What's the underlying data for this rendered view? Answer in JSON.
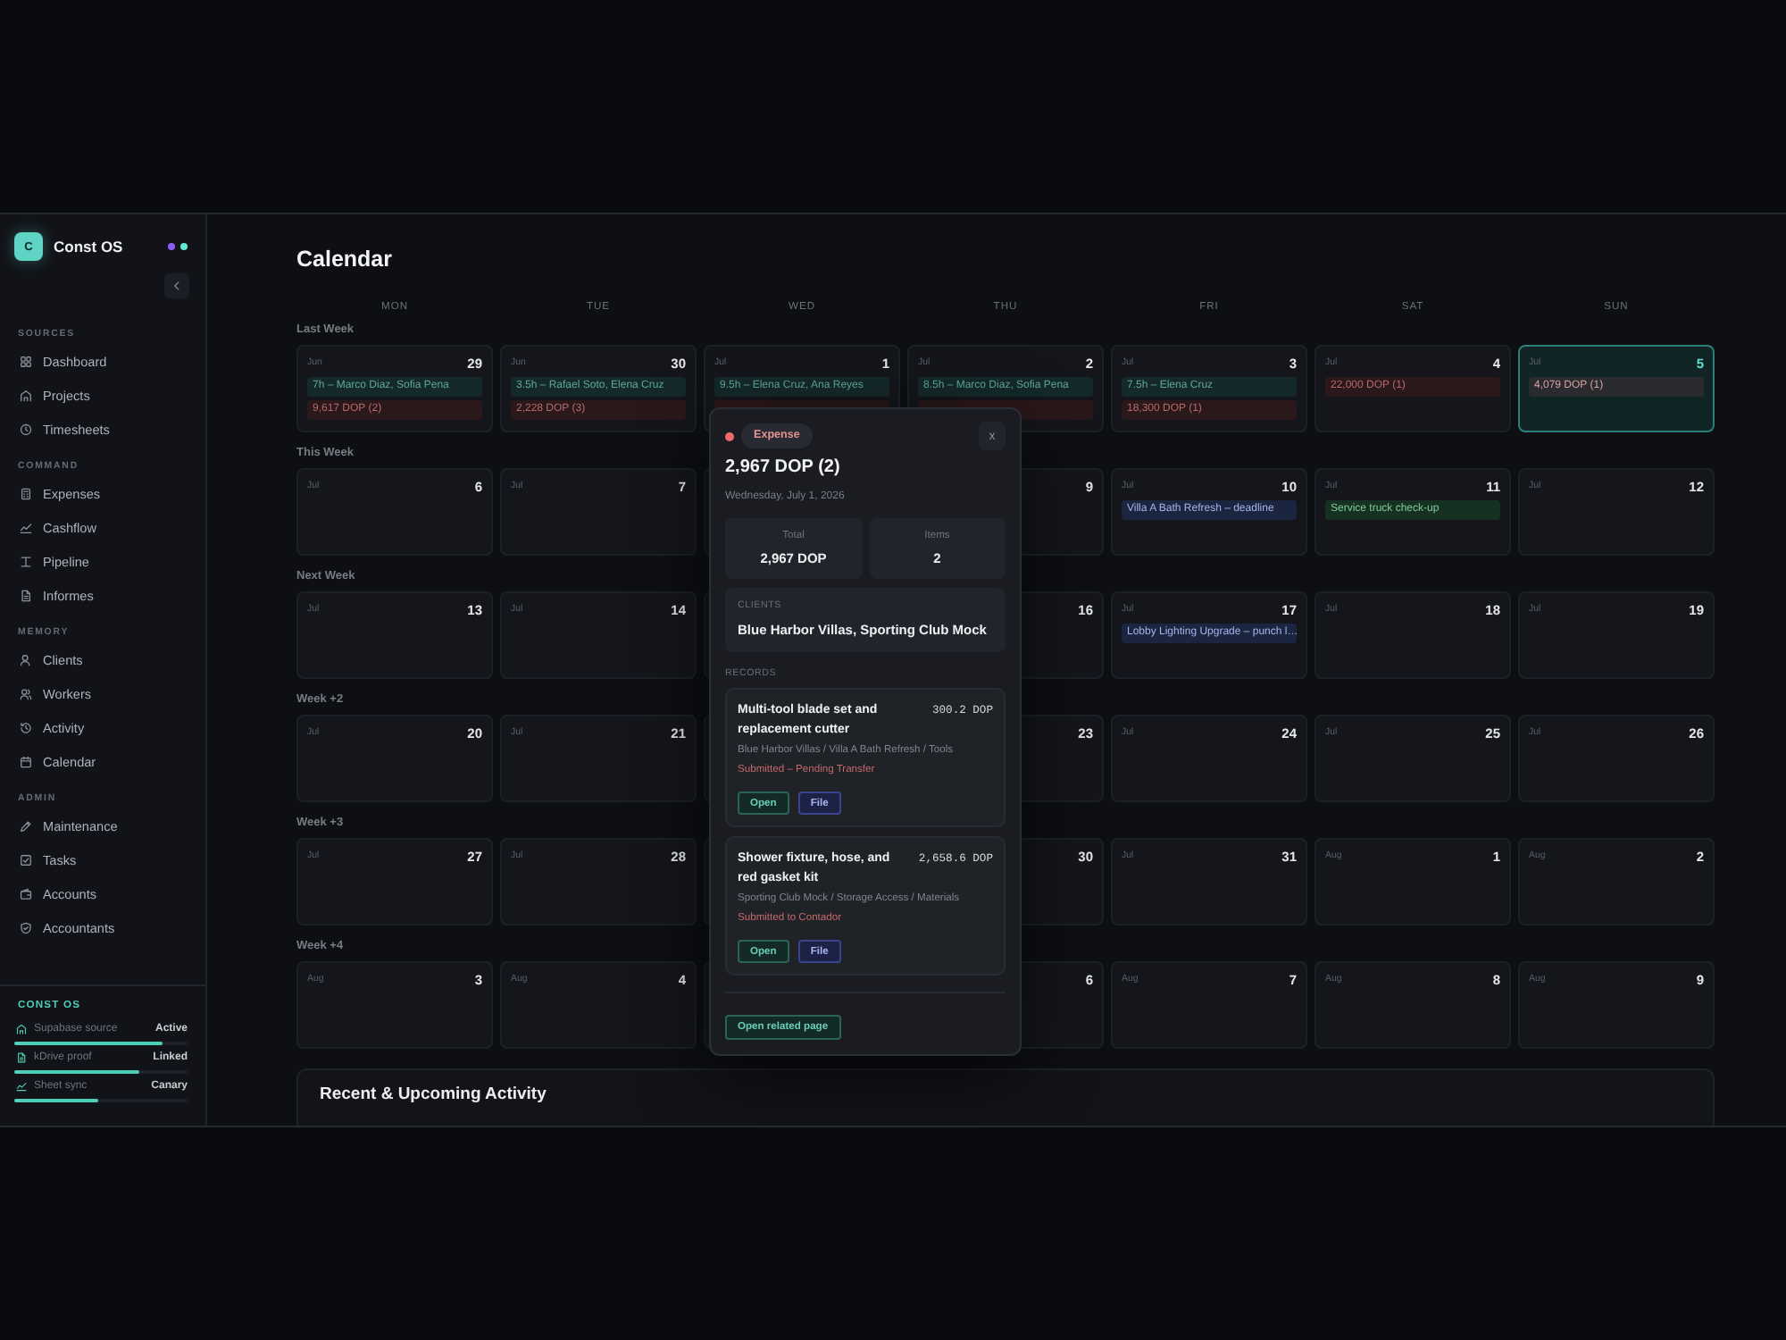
{
  "sidebar": {
    "brand": {
      "logo": "C",
      "name": "Const OS",
      "status_dots": [
        {
          "color": "#8b5cf6"
        },
        {
          "color": "#5eead4"
        }
      ]
    },
    "sections": [
      {
        "title": "SOURCES",
        "items": [
          {
            "label": "Dashboard",
            "selected": false
          },
          {
            "label": "Projects",
            "selected": false
          },
          {
            "label": "Timesheets",
            "selected": false
          }
        ]
      },
      {
        "title": "COMMAND",
        "items": [
          {
            "label": "Expenses",
            "selected": false
          },
          {
            "label": "Cashflow",
            "selected": false
          },
          {
            "label": "Pipeline",
            "selected": false
          },
          {
            "label": "Informes",
            "selected": false
          }
        ]
      },
      {
        "title": "MEMORY",
        "items": [
          {
            "label": "Clients",
            "selected": false
          },
          {
            "label": "Workers",
            "selected": false
          },
          {
            "label": "Activity",
            "selected": false
          },
          {
            "label": "Calendar",
            "selected": false
          }
        ]
      },
      {
        "title": "ADMIN",
        "items": [
          {
            "label": "Maintenance",
            "selected": false
          },
          {
            "label": "Tasks",
            "selected": false
          },
          {
            "label": "Accounts",
            "selected": false
          },
          {
            "label": "Accountants",
            "selected": false
          }
        ]
      }
    ],
    "footer": {
      "title": "CONST OS",
      "sources": [
        {
          "label": "Supabase source",
          "status": "Active",
          "level": 0.86
        },
        {
          "label": "kDrive proof",
          "status": "Linked",
          "level": 0.72
        },
        {
          "label": "Sheet sync",
          "status": "Canary",
          "level": 0.48
        }
      ]
    }
  },
  "page": {
    "title": "Calendar"
  },
  "calendar": {
    "weekdays": [
      "MON",
      "TUE",
      "WED",
      "THU",
      "FRI",
      "SAT",
      "SUN"
    ],
    "weeks": [
      {
        "label": "Last Week",
        "days": [
          {
            "month": "Jun",
            "day": "29",
            "today": false,
            "events": [
              {
                "kind": "hours",
                "label": "7h – Marco Diaz, Sofia Pena"
              },
              {
                "kind": "expense",
                "label": "9,617 DOP (2)"
              }
            ]
          },
          {
            "month": "Jun",
            "day": "30",
            "today": false,
            "events": [
              {
                "kind": "hours",
                "label": "3.5h – Rafael Soto, Elena Cruz"
              },
              {
                "kind": "expense",
                "label": "2,228 DOP (3)"
              }
            ]
          },
          {
            "month": "Jul",
            "day": "1",
            "today": false,
            "events": [
              {
                "kind": "hours",
                "label": "9.5h – Elena Cruz, Ana Reyes"
              },
              {
                "kind": "expense"
              }
            ]
          },
          {
            "month": "Jul",
            "day": "2",
            "today": false,
            "events": [
              {
                "kind": "hours",
                "label": "8.5h – Marco Diaz, Sofia Pena"
              },
              {
                "kind": "expense"
              }
            ]
          },
          {
            "month": "Jul",
            "day": "3",
            "today": false,
            "events": [
              {
                "kind": "hours",
                "label": "7.5h – Elena Cruz"
              },
              {
                "kind": "expense",
                "label": "18,300 DOP (1)"
              }
            ]
          },
          {
            "month": "Jul",
            "day": "4",
            "today": false,
            "events": [
              {
                "kind": "expense",
                "label": "22,000 DOP (1)"
              }
            ]
          },
          {
            "month": "Jul",
            "day": "5",
            "today": true,
            "events": [
              {
                "kind": "expense",
                "label": "4,079 DOP (1)"
              }
            ]
          }
        ]
      },
      {
        "label": "This Week",
        "days": [
          {
            "month": "Jul",
            "day": "6",
            "today": false
          },
          {
            "month": "Jul",
            "day": "7",
            "today": false
          },
          {
            "today": false
          },
          {
            "day": "9",
            "today": false
          },
          {
            "month": "Jul",
            "day": "10",
            "today": false,
            "events": [
              {
                "kind": "deadline",
                "label": "Villa A Bath Refresh – deadline"
              }
            ]
          },
          {
            "month": "Jul",
            "day": "11",
            "today": false,
            "events": [
              {
                "kind": "service",
                "label": "Service truck check-up"
              }
            ]
          },
          {
            "month": "Jul",
            "day": "12",
            "today": false
          }
        ]
      },
      {
        "label": "Next Week",
        "days": [
          {
            "month": "Jul",
            "day": "13",
            "today": false
          },
          {
            "month": "Jul",
            "day": "14",
            "today": false
          },
          {
            "today": false
          },
          {
            "day": "16",
            "today": false
          },
          {
            "month": "Jul",
            "day": "17",
            "today": false,
            "events": [
              {
                "kind": "deadline",
                "label": "Lobby Lighting Upgrade – punch l…"
              }
            ]
          },
          {
            "month": "Jul",
            "day": "18",
            "today": false
          },
          {
            "month": "Jul",
            "day": "19",
            "today": false
          }
        ]
      },
      {
        "label": "Week +2",
        "days": [
          {
            "month": "Jul",
            "day": "20",
            "today": false
          },
          {
            "month": "Jul",
            "day": "21",
            "today": false
          },
          {
            "today": false
          },
          {
            "day": "23",
            "today": false
          },
          {
            "month": "Jul",
            "day": "24",
            "today": false
          },
          {
            "month": "Jul",
            "day": "25",
            "today": false
          },
          {
            "month": "Jul",
            "day": "26",
            "today": false
          }
        ]
      },
      {
        "label": "Week +3",
        "days": [
          {
            "month": "Jul",
            "day": "27",
            "today": false
          },
          {
            "month": "Jul",
            "day": "28",
            "today": false
          },
          {
            "today": false
          },
          {
            "day": "30",
            "today": false
          },
          {
            "month": "Jul",
            "day": "31",
            "today": false
          },
          {
            "month": "Aug",
            "day": "1",
            "today": false
          },
          {
            "month": "Aug",
            "day": "2",
            "today": false
          }
        ]
      },
      {
        "label": "Week +4",
        "days": [
          {
            "month": "Aug",
            "day": "3",
            "today": false
          },
          {
            "month": "Aug",
            "day": "4",
            "today": false
          },
          {
            "today": false
          },
          {
            "day": "6",
            "today": false
          },
          {
            "month": "Aug",
            "day": "7",
            "today": false
          },
          {
            "month": "Aug",
            "day": "8",
            "today": false
          },
          {
            "month": "Aug",
            "day": "9",
            "today": false
          }
        ]
      }
    ]
  },
  "popup": {
    "kind": "expense",
    "badge": "Expense",
    "close": "x",
    "title": "2,967 DOP (2)",
    "date": "Wednesday, July 1, 2026",
    "stats": [
      {
        "label": "Total",
        "value": "2,967 DOP"
      },
      {
        "label": "Items",
        "value": "2"
      }
    ],
    "clients": {
      "label": "CLIENTS",
      "value": "Blue Harbor Villas, Sporting Club Mock"
    },
    "records_label": "RECORDS",
    "records": [
      {
        "title": "Multi-tool blade set and replacement cutter",
        "amount": "300.2 DOP",
        "path": "Blue Harbor Villas / Villa A Bath Refresh / Tools",
        "status": "Submitted – Pending Transfer",
        "actions": [
          {
            "kind": "open",
            "label": "Open"
          },
          {
            "kind": "file",
            "label": "File"
          }
        ]
      },
      {
        "title": "Shower fixture, hose, and red gasket kit",
        "amount": "2,658.6 DOP",
        "path": "Sporting Club Mock / Storage Access / Materials",
        "status": "Submitted to Contador",
        "actions": [
          {
            "kind": "open",
            "label": "Open"
          },
          {
            "kind": "file",
            "label": "File"
          }
        ]
      }
    ],
    "related": "Open related page"
  },
  "activity": {
    "title": "Recent & Upcoming Activity"
  }
}
